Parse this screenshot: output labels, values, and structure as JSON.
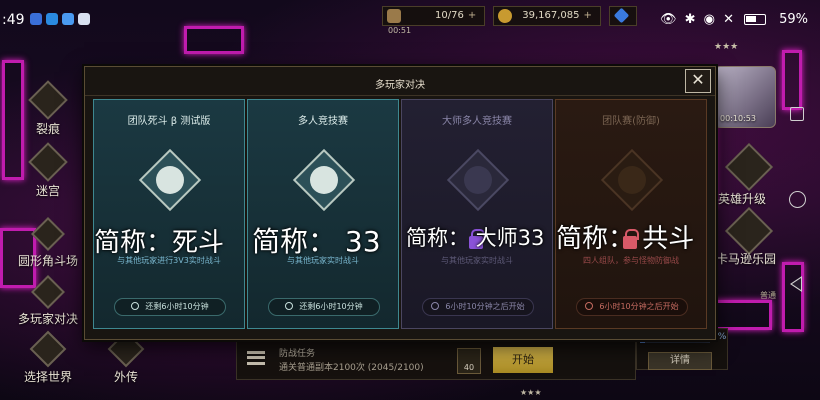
{
  "status_bar": {
    "time": ":49",
    "right_icons": "👁 ✱ ◉ ✕",
    "battery_pct": "59%"
  },
  "resources": {
    "energy": "10/76",
    "gold": "39,167,085",
    "timer": "00:51"
  },
  "left_menu": {
    "items": [
      "裂痕",
      "迷宫",
      "圆形角斗场",
      "多玩家对决",
      "选择世界",
      "外传"
    ]
  },
  "right_menu": {
    "stars": "★★★",
    "avatar_time": "00:10:53",
    "hero_upgrade": "英雄升级",
    "carnival": "卡马逊乐园",
    "hint": "普通"
  },
  "modal": {
    "title": "多玩家对决",
    "close_label": "✕",
    "cards": [
      {
        "title": "团队死斗 β 测试版",
        "desc": "与其他玩家进行3V3实时战斗",
        "status": "还剩6小时10分钟",
        "overlay": "简称：死斗",
        "locked": false,
        "theme": "teal"
      },
      {
        "title": "多人竞技赛",
        "desc": "与其他玩家实时战斗",
        "status": "还剩6小时10分钟",
        "overlay": "简称： 33",
        "locked": false,
        "theme": "teal"
      },
      {
        "title": "大师多人竞技赛",
        "desc": "与其他玩家实时战斗",
        "status": "6小时10分钟之后开始",
        "overlay": "简称： 大师33",
        "locked": true,
        "theme": "purple"
      },
      {
        "title": "团队赛(防御)",
        "desc": "四人组队，参与怪物防御战",
        "status": "6小时10分钟之后开始",
        "overlay": "简称： 共斗",
        "locked": true,
        "theme": "brown"
      }
    ]
  },
  "task_bar": {
    "title": "防战任务",
    "desc": "通关普通副本2100次 (2045/2100)",
    "count": "40",
    "start_label": "开始"
  },
  "detail_panel": {
    "progress_label": "7%",
    "progress_fraction": 0.07,
    "detail_label": "详情"
  },
  "bottom_stars": "★★★"
}
